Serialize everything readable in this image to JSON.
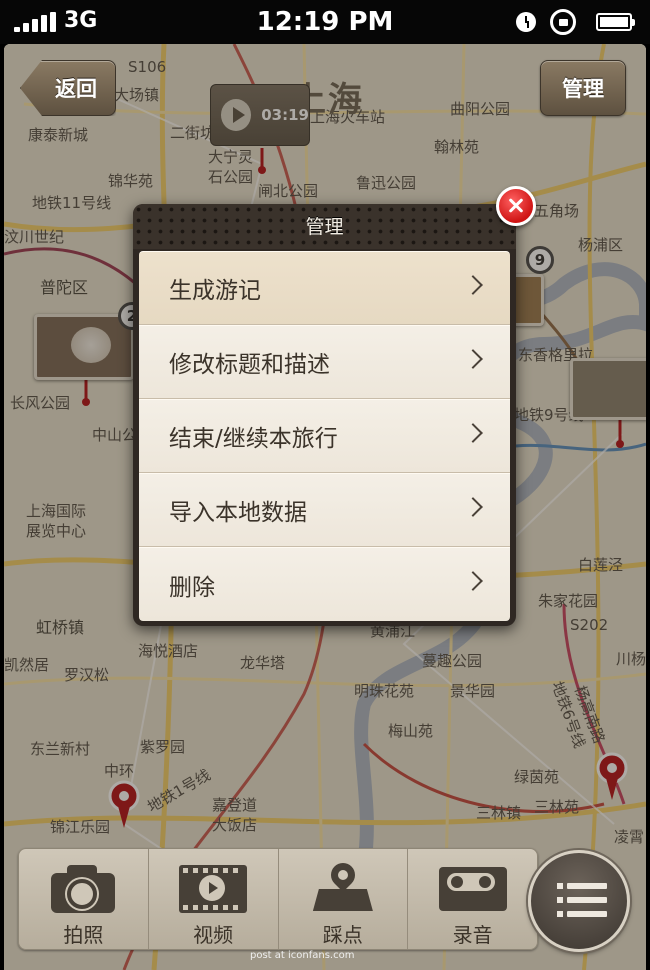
{
  "status_bar": {
    "carrier": "3G",
    "time": "12:19 PM"
  },
  "header": {
    "back_label": "返回",
    "city": "上海",
    "manage_label": "管理"
  },
  "video_chip": {
    "duration": "03:19"
  },
  "badges": {
    "b1": "2",
    "b2": "9"
  },
  "map_labels": [
    "S106",
    "大场镇",
    "二街坊",
    "康泰新城",
    "锦华苑",
    "大宁灵",
    "石公园",
    "闸北公园",
    "上海火车站",
    "鲁迅公园",
    "曲阳公园",
    "翰林苑",
    "五角场",
    "杨浦区",
    "地铁11号线",
    "汶川世纪",
    "普陀区",
    "长风公园",
    "中山公",
    "东香格里拉",
    "地铁9号线",
    "上海国际",
    "展览中心",
    "白莲泾",
    "朱家花园",
    "S202",
    "虹桥镇",
    "海悦酒店",
    "龙华塔",
    "黄浦江",
    "蔓趣公园",
    "川杨",
    "凯然居",
    "罗汉松",
    "明珠花苑",
    "景华园",
    "梅山苑",
    "东兰新村",
    "紫罗园",
    "嘉登道",
    "大饭店",
    "绿茵苑",
    "三林镇",
    "三林苑",
    "锦江乐园",
    "地铁1号线",
    "中环",
    "地铁6号线",
    "杨高南路",
    "凌霄"
  ],
  "popup": {
    "title": "管理",
    "items": [
      "生成游记",
      "修改标题和描述",
      "结束/继续本旅行",
      "导入本地数据",
      "删除"
    ]
  },
  "toolbar": {
    "photo": "拍照",
    "video": "视频",
    "spot": "踩点",
    "record": "录音"
  },
  "watermark": "post at iconfans.com",
  "colors": {
    "close": "#d61818",
    "pin": "#b3141b",
    "toolbar_bg": "#c4bcad"
  }
}
